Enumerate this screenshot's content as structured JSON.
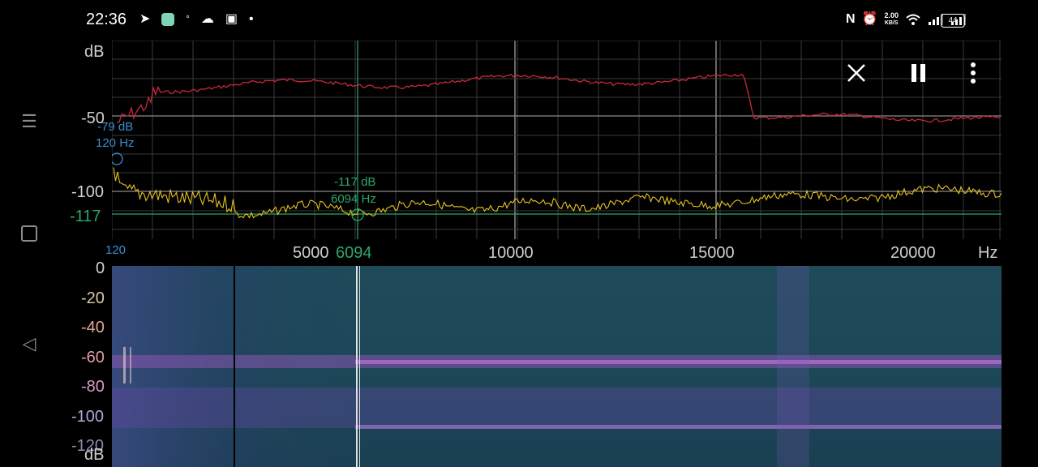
{
  "status_bar": {
    "time": "22:36",
    "network_speed_value": "2.00",
    "network_speed_unit": "KB/S",
    "battery": "44",
    "left_icons": [
      "telegram-icon",
      "app-icon",
      "temperature-icon",
      "cloud-icon",
      "news-icon",
      "dot-icon"
    ],
    "right_icons": [
      "nfc-icon",
      "alarm-icon",
      "wifi-icon",
      "signal-icon",
      "signal-icon-2"
    ]
  },
  "spectrum": {
    "db_unit": "dB",
    "y_ticks": [
      "-50",
      "-100"
    ],
    "hz_unit": "Hz",
    "x_ticks": [
      "5000",
      "10000",
      "15000",
      "20000"
    ],
    "cursor": {
      "db_label": "-117",
      "hz_label": "6094",
      "info_db": "-117 dB",
      "info_hz": "6094 Hz"
    },
    "peak": {
      "start_hz": "120",
      "info_db": "-79 dB",
      "info_hz": "120 Hz"
    },
    "colors": {
      "peak_line": "#c8283c",
      "current_line": "#e8c21e",
      "cursor": "#2aa86a",
      "peak_marker": "#3b8fd1",
      "grid": "#3a3a3a"
    }
  },
  "spectrogram": {
    "unit": "dB",
    "scale": [
      "0",
      "-20",
      "-40",
      "-60",
      "-80",
      "-100",
      "-120"
    ]
  },
  "controls": {
    "close": "close-icon",
    "pause": "pause-icon",
    "menu": "more-vert-icon"
  }
}
